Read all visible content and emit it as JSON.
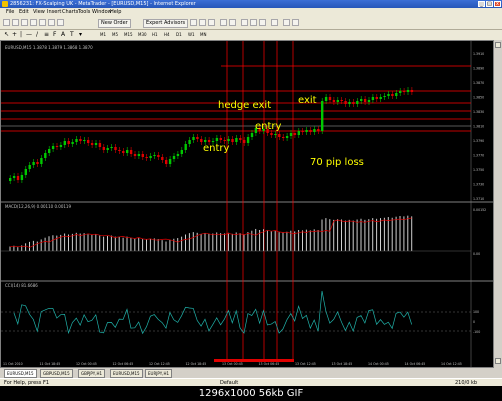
{
  "window": {
    "title": "2856231: FX-Scalping UK - MetaTrader - [EURUSD,M15] - Internet Explorer",
    "minimize": "_",
    "maximize": "□",
    "close": "x"
  },
  "menu": [
    "File",
    "Edit",
    "View",
    "Insert",
    "Charts",
    "Tools",
    "Window",
    "Help"
  ],
  "toolbar": {
    "new_order": "New Order",
    "expert_advisors": "Expert Advisors",
    "timeframes": [
      "M1",
      "M5",
      "M15",
      "M30",
      "H1",
      "H4",
      "D1",
      "W1",
      "MN"
    ]
  },
  "chart": {
    "symbol_label": "EURUSD,M15  1.3878 1.3879 1.3868 1.3870",
    "annotations": {
      "hedge_exit": "hedge exit",
      "entry1": "entry",
      "entry2": "entry",
      "exit": "exit",
      "loss": "70 pip loss"
    },
    "price_ticks": [
      "1.3910",
      "1.3890",
      "1.3870",
      "1.3850",
      "1.3830",
      "1.3810",
      "1.3790",
      "1.3770",
      "1.3750",
      "1.3730",
      "1.3710"
    ],
    "macd_label": "MACD(12,26,9) 0.00110 0.00119",
    "macd_ticks": [
      "0.00152",
      "0.00"
    ],
    "cci_label": "CCI(14) 81.6686",
    "cci_ticks": [
      "100",
      "0",
      "-100"
    ],
    "time_ticks": [
      "11 Oct 2010",
      "11 Oct 18:45",
      "12 Oct 00:45",
      "12 Oct 06:45",
      "12 Oct 12:45",
      "12 Oct 18:45",
      "13 Oct 00:45",
      "13 Oct 06:45",
      "13 Oct 12:45",
      "13 Oct 18:45",
      "14 Oct 00:45",
      "14 Oct 06:45",
      "14 Oct 12:45"
    ]
  },
  "tabs": [
    "EURUSD,M15",
    "GBPUSD,M15",
    "GBPJPY,H1",
    "EURUSD,M15",
    "EURJPY,H1"
  ],
  "status": {
    "help": "For Help, press F1",
    "profile": "Default",
    "connection": "210/0 kb"
  },
  "footer": "1296x1000  56kb  GIF",
  "colors": {
    "bull": "#00c800",
    "bear": "#e00000",
    "annotation": "#ffff00",
    "grid_line": "#ff0000"
  }
}
